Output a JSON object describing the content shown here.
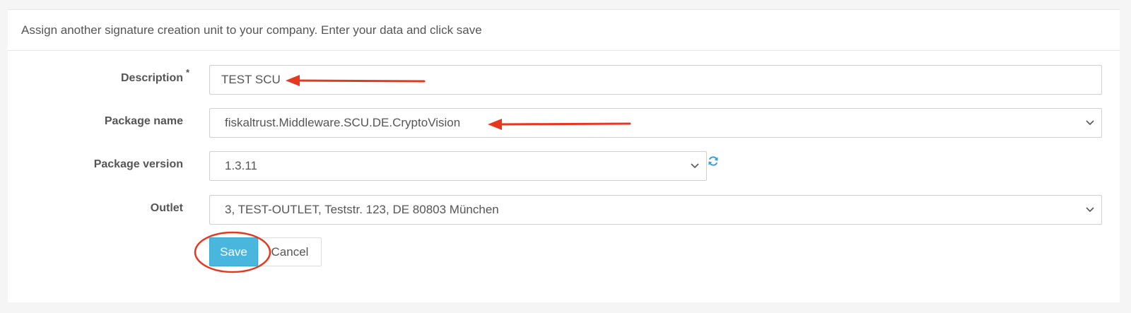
{
  "header": {
    "text": "Assign another signature creation unit to your company. Enter your data and click save"
  },
  "form": {
    "description": {
      "label": "Description",
      "required_mark": "*",
      "value": "TEST SCU"
    },
    "package_name": {
      "label": "Package name",
      "value": "fiskaltrust.Middleware.SCU.DE.CryptoVision"
    },
    "package_version": {
      "label": "Package version",
      "value": "1.3.11"
    },
    "outlet": {
      "label": "Outlet",
      "value": "3, TEST-OUTLET, Teststr. 123, DE 80803 München"
    }
  },
  "buttons": {
    "save": "Save",
    "cancel": "Cancel"
  },
  "colors": {
    "primary_button": "#49b6dd",
    "annotation": "#e8371f",
    "refresh_icon": "#3a9fd6"
  },
  "icons": {
    "chevron": "chevron-down-icon",
    "refresh": "refresh-icon"
  }
}
